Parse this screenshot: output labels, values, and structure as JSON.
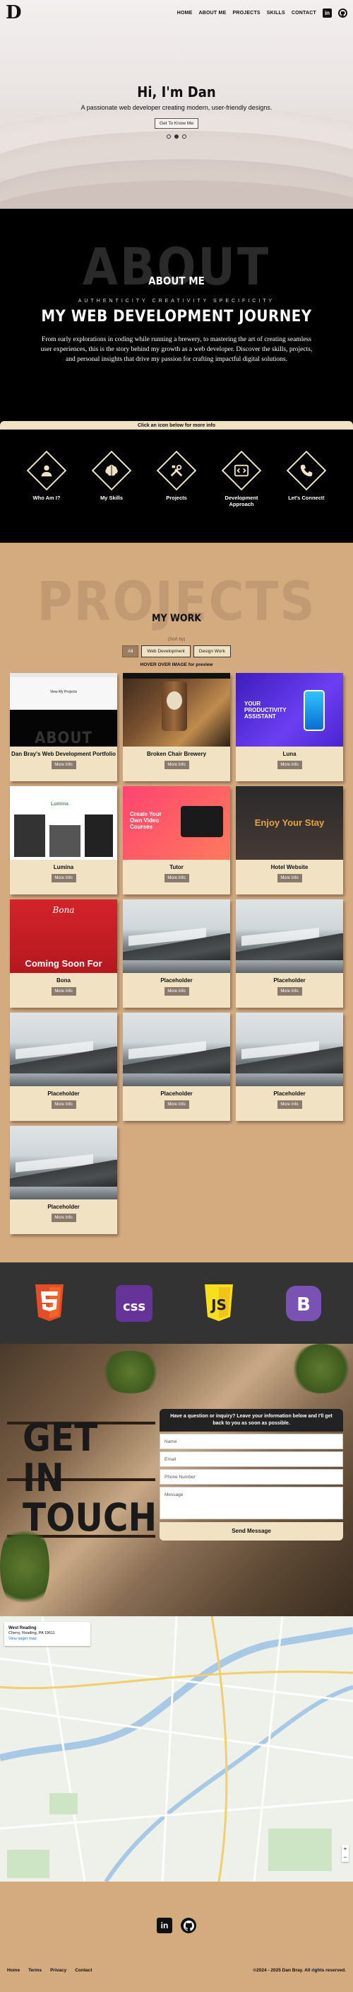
{
  "nav": {
    "logo": "D",
    "links": [
      "HOME",
      "ABOUT ME",
      "PROJECTS",
      "SKILLS",
      "CONTACT"
    ],
    "icons": [
      "linkedin-icon",
      "github-icon"
    ]
  },
  "hero": {
    "title": "Hi, I'm Dan",
    "subtitle": "A passionate web developer creating modern, user-friendly designs.",
    "button": "Get To Know Me",
    "slides": 3,
    "active_slide": 1
  },
  "about": {
    "bg_text": "ABOUT",
    "title": "ABOUT ME",
    "tags": "AUTHENTICITY CREATIVITY SPECIFICITY",
    "heading": "MY WEB DEVELOPMENT JOURNEY",
    "paragraph": "From early explorations in coding while running a brewery, to mastering the art of creating seamless user experiences, this is the story behind my growth as a web developer. Discover the skills, projects, and personal insights that drive my passion for crafting impactful digital solutions.",
    "click_bar": "Click an icon below for more info",
    "icons": [
      {
        "label": "Who Am I?",
        "icon": "person-icon"
      },
      {
        "label": "My Skills",
        "icon": "brain-icon"
      },
      {
        "label": "Projects",
        "icon": "tools-icon"
      },
      {
        "label": "Development Approach",
        "icon": "code-icon"
      },
      {
        "label": "Let's Connect!",
        "icon": "phone-icon"
      }
    ]
  },
  "projects": {
    "bg_text": "PROJECTS",
    "title": "MY WORK",
    "sort_label": "(Sort by)",
    "filters": [
      "All",
      "Web Development",
      "Design Work"
    ],
    "active_filter": "All",
    "hover_note": "HOVER OVER IMAGE for preview",
    "button_label": "More Info",
    "items": [
      {
        "title": "Dan Bray's Web Development Portfolio",
        "thumb": "portfolio"
      },
      {
        "title": "Broken Chair Brewery",
        "thumb": "brewery"
      },
      {
        "title": "Luna",
        "thumb": "luna"
      },
      {
        "title": "Lumina",
        "thumb": "lumina"
      },
      {
        "title": "Tutor",
        "thumb": "tutor"
      },
      {
        "title": "Hotel Website",
        "thumb": "hotel"
      },
      {
        "title": "Bona",
        "thumb": "bona"
      },
      {
        "title": "Placeholder",
        "thumb": "water"
      },
      {
        "title": "Placeholder",
        "thumb": "water"
      },
      {
        "title": "Placeholder",
        "thumb": "water"
      },
      {
        "title": "Placeholder",
        "thumb": "water"
      },
      {
        "title": "Placeholder",
        "thumb": "water"
      },
      {
        "title": "Placeholder",
        "thumb": "water"
      }
    ],
    "thumb_text": {
      "portfolio_heading": "View My Projects",
      "portfolio_bg": "ABOUT",
      "luna": "YOUR PRODUCTIVITY ASSISTANT",
      "lumina": "Lumina",
      "tutor": "Create Your Own Video Courses",
      "hotel": "Enjoy Your Stay",
      "bona": "Bona",
      "bona_soon": "Coming Soon For"
    }
  },
  "skills": [
    {
      "name": "HTML5",
      "icon": "html5-icon",
      "color": "#e44d26"
    },
    {
      "name": "CSS",
      "icon": "css-icon",
      "color": "#663399"
    },
    {
      "name": "JS",
      "icon": "js-icon",
      "color": "#f7df1e"
    },
    {
      "name": "Bootstrap",
      "icon": "bootstrap-icon",
      "color": "#7952b3"
    }
  ],
  "contact": {
    "heading_lines": [
      "GET",
      "IN",
      "TOUCH"
    ],
    "form_head": "Have a question or inquiry? Leave your information below and I'll get back to you as soon as possible.",
    "fields": [
      "Name",
      "Email",
      "Phone Number",
      "Message"
    ],
    "send": "Send Message"
  },
  "map": {
    "place": "West Reading",
    "address": "Cherry, Reading, PA 19611",
    "link": "View larger map",
    "zoom": [
      "+",
      "−"
    ]
  },
  "footer": {
    "icons": [
      "linkedin-icon",
      "github-icon"
    ],
    "links": [
      "Home",
      "Terms",
      "Privacy",
      "Contact"
    ],
    "copyright": "©2024 - 2025 Dan Bray. All rights reserved."
  }
}
